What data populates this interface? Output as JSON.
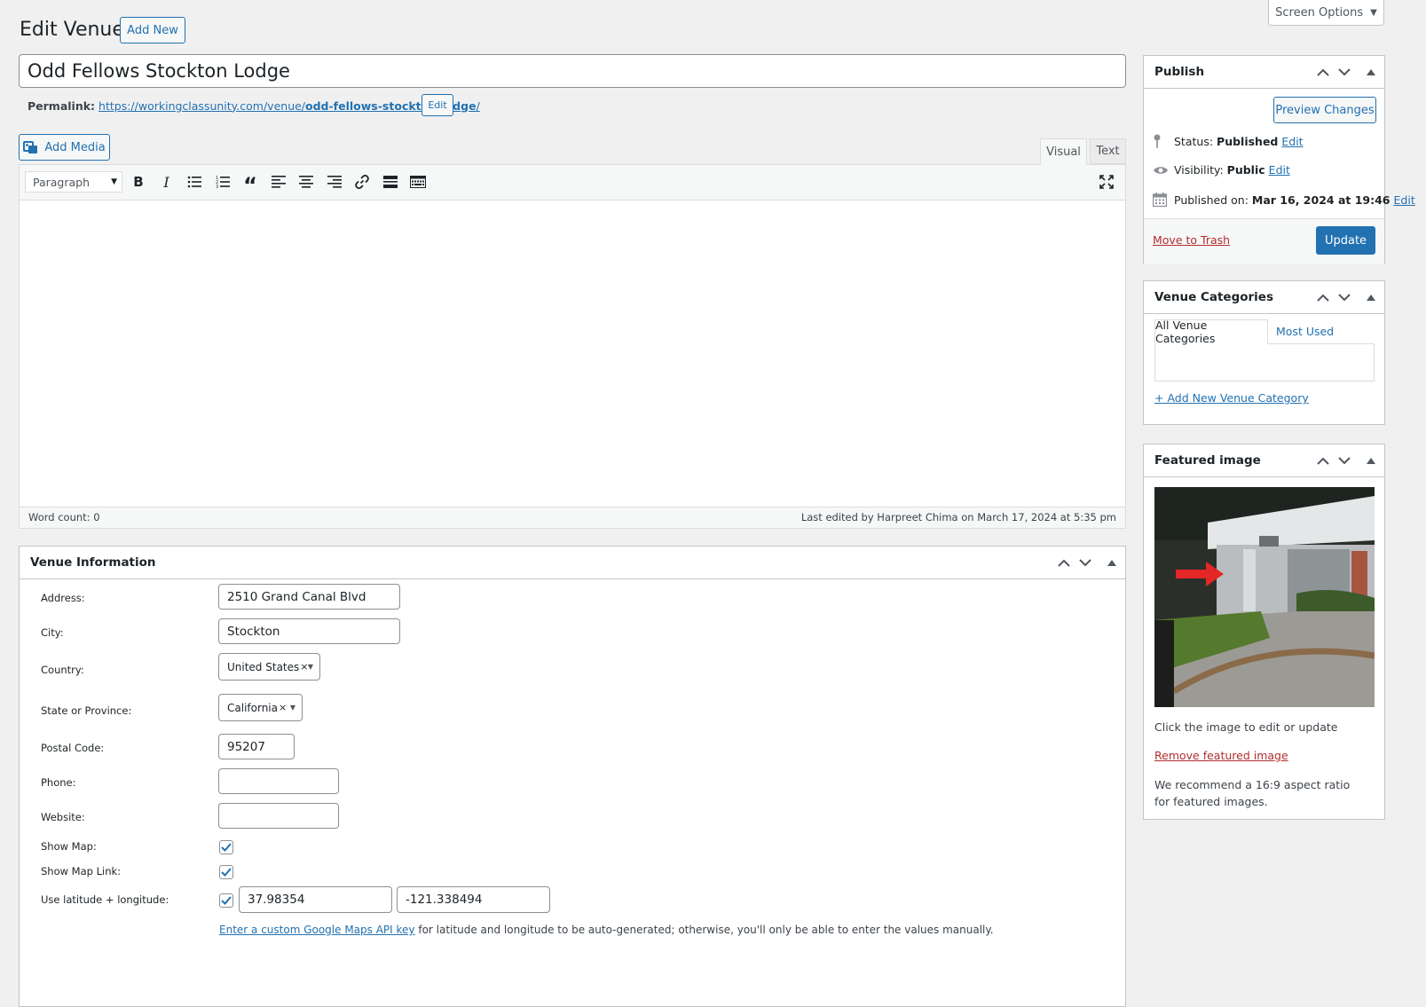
{
  "screen_options": "Screen Options",
  "page_title": "Edit Venue",
  "add_new": "Add New",
  "post_title": "Odd Fellows Stockton Lodge",
  "permalink": {
    "label": "Permalink:",
    "url_prefix": "https://workingclassunity.com/venue/",
    "slug": "odd-fellows-stockton-lodge",
    "url_suffix": "/",
    "edit": "Edit"
  },
  "add_media": "Add Media",
  "editor": {
    "tab_visual": "Visual",
    "tab_text": "Text",
    "format_select": "Paragraph",
    "word_count": "Word count: 0",
    "last_edited": "Last edited by Harpreet Chima on March 17, 2024 at 5:35 pm"
  },
  "venue_info": {
    "title": "Venue Information",
    "address_label": "Address:",
    "address_value": "2510 Grand Canal Blvd",
    "city_label": "City:",
    "city_value": "Stockton",
    "country_label": "Country:",
    "country_value": "United States",
    "state_label": "State or Province:",
    "state_value": "California",
    "postal_label": "Postal Code:",
    "postal_value": "95207",
    "phone_label": "Phone:",
    "phone_value": "",
    "website_label": "Website:",
    "website_value": "",
    "show_map_label": "Show Map:",
    "show_map": true,
    "show_map_link_label": "Show Map Link:",
    "show_map_link": true,
    "latlng_label": "Use latitude + longitude:",
    "use_latlng": true,
    "latitude": "37.98354",
    "longitude": "-121.338494",
    "api_link": "Enter a custom Google Maps API key",
    "api_note": " for latitude and longitude to be auto-generated; otherwise, you'll only be able to enter the values manually."
  },
  "publish": {
    "title": "Publish",
    "preview": "Preview Changes",
    "status_label": "Status: ",
    "status_value": "Published",
    "visibility_label": "Visibility: ",
    "visibility_value": "Public",
    "published_label": "Published on: ",
    "published_value": "Mar 16, 2024 at 19:46",
    "edit": "Edit",
    "trash": "Move to Trash",
    "update": "Update"
  },
  "categories": {
    "title": "Venue Categories",
    "tab_all": "All Venue Categories",
    "tab_most_used": "Most Used",
    "add_new": "+ Add New Venue Category"
  },
  "featured": {
    "title": "Featured image",
    "hint": "Click the image to edit or update",
    "remove": "Remove featured image",
    "recommend": "We recommend a 16:9 aspect ratio for featured images."
  },
  "colors": {
    "accent": "#2271b1",
    "danger": "#b32d2e",
    "background": "#f0f0f1"
  }
}
